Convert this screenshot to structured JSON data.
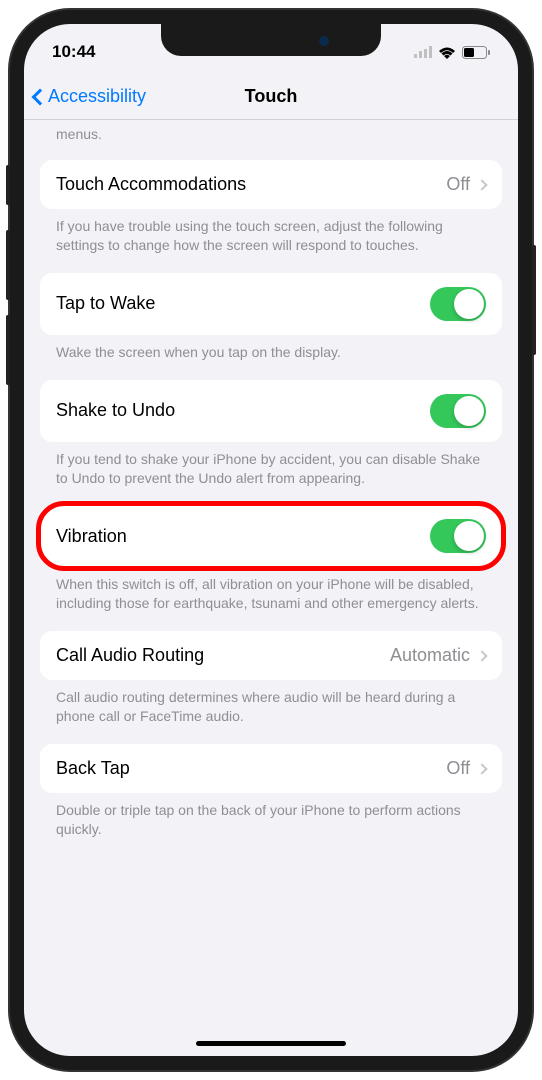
{
  "status": {
    "time": "10:44"
  },
  "nav": {
    "back": "Accessibility",
    "title": "Touch"
  },
  "header_truncated": "menus.",
  "rows": {
    "touch_accommodations": {
      "label": "Touch Accommodations",
      "value": "Off",
      "footer": "If you have trouble using the touch screen, adjust the following settings to change how the screen will respond to touches."
    },
    "tap_to_wake": {
      "label": "Tap to Wake",
      "on": true,
      "footer": "Wake the screen when you tap on the display."
    },
    "shake_to_undo": {
      "label": "Shake to Undo",
      "on": true,
      "footer": "If you tend to shake your iPhone by accident, you can disable Shake to Undo to prevent the Undo alert from appearing."
    },
    "vibration": {
      "label": "Vibration",
      "on": true,
      "footer": "When this switch is off, all vibration on your iPhone will be disabled, including those for earthquake, tsunami and other emergency alerts."
    },
    "call_audio": {
      "label": "Call Audio Routing",
      "value": "Automatic",
      "footer": "Call audio routing determines where audio will be heard during a phone call or FaceTime audio."
    },
    "back_tap": {
      "label": "Back Tap",
      "value": "Off",
      "footer": "Double or triple tap on the back of your iPhone to perform actions quickly."
    }
  }
}
